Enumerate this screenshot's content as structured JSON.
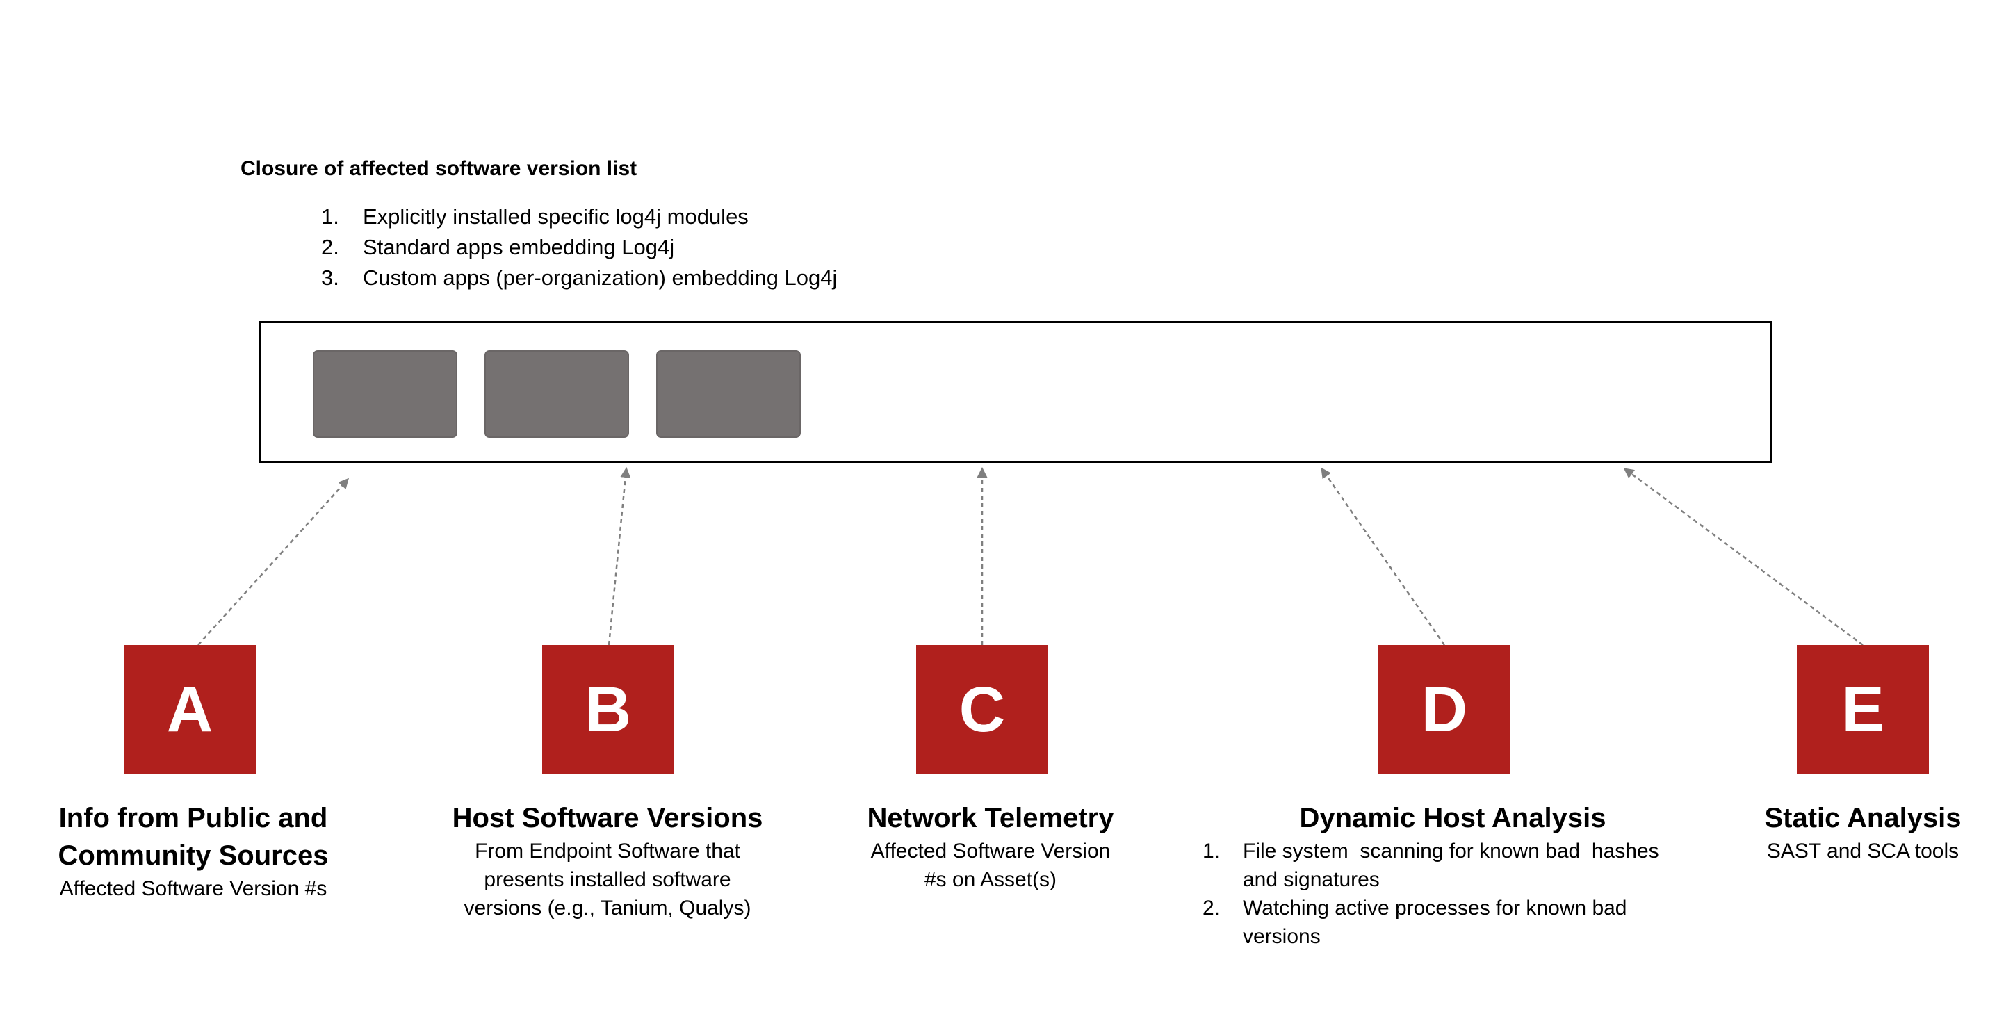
{
  "closure": {
    "title": "Closure of affected software version list",
    "items": [
      {
        "num": "1.",
        "text": "Explicitly installed specific log4j modules"
      },
      {
        "num": "2.",
        "text": "Standard apps embedding Log4j"
      },
      {
        "num": "3.",
        "text": "Custom apps (per-organization) embedding Log4j"
      }
    ]
  },
  "version_box": {
    "slot_count": 3
  },
  "colors": {
    "letter_box": "#b0201d",
    "slot": "#757171",
    "arrow": "#7f7f7f"
  },
  "sources": [
    {
      "letter": "A",
      "title_lines": [
        "Info from Public and",
        "Community Sources"
      ],
      "desc_lines": [
        "Affected Software Version #s"
      ]
    },
    {
      "letter": "B",
      "title_lines": [
        "Host Software Versions"
      ],
      "desc_lines": [
        "From Endpoint Software that",
        "presents installed software",
        "versions (e.g., Tanium, Qualys)"
      ]
    },
    {
      "letter": "C",
      "title_lines": [
        "Network Telemetry"
      ],
      "desc_lines": [
        "Affected Software Version",
        "#s on Asset(s)"
      ]
    },
    {
      "letter": "D",
      "title_lines": [
        "Dynamic Host Analysis"
      ],
      "list": [
        {
          "num": "1.",
          "lines": [
            "File system  scanning for known bad  hashes",
            "and signatures"
          ]
        },
        {
          "num": "2.",
          "lines": [
            "Watching active processes for known bad",
            "versions"
          ]
        }
      ]
    },
    {
      "letter": "E",
      "title_lines": [
        "Static Analysis"
      ],
      "desc_lines": [
        "SAST and SCA tools"
      ]
    }
  ]
}
